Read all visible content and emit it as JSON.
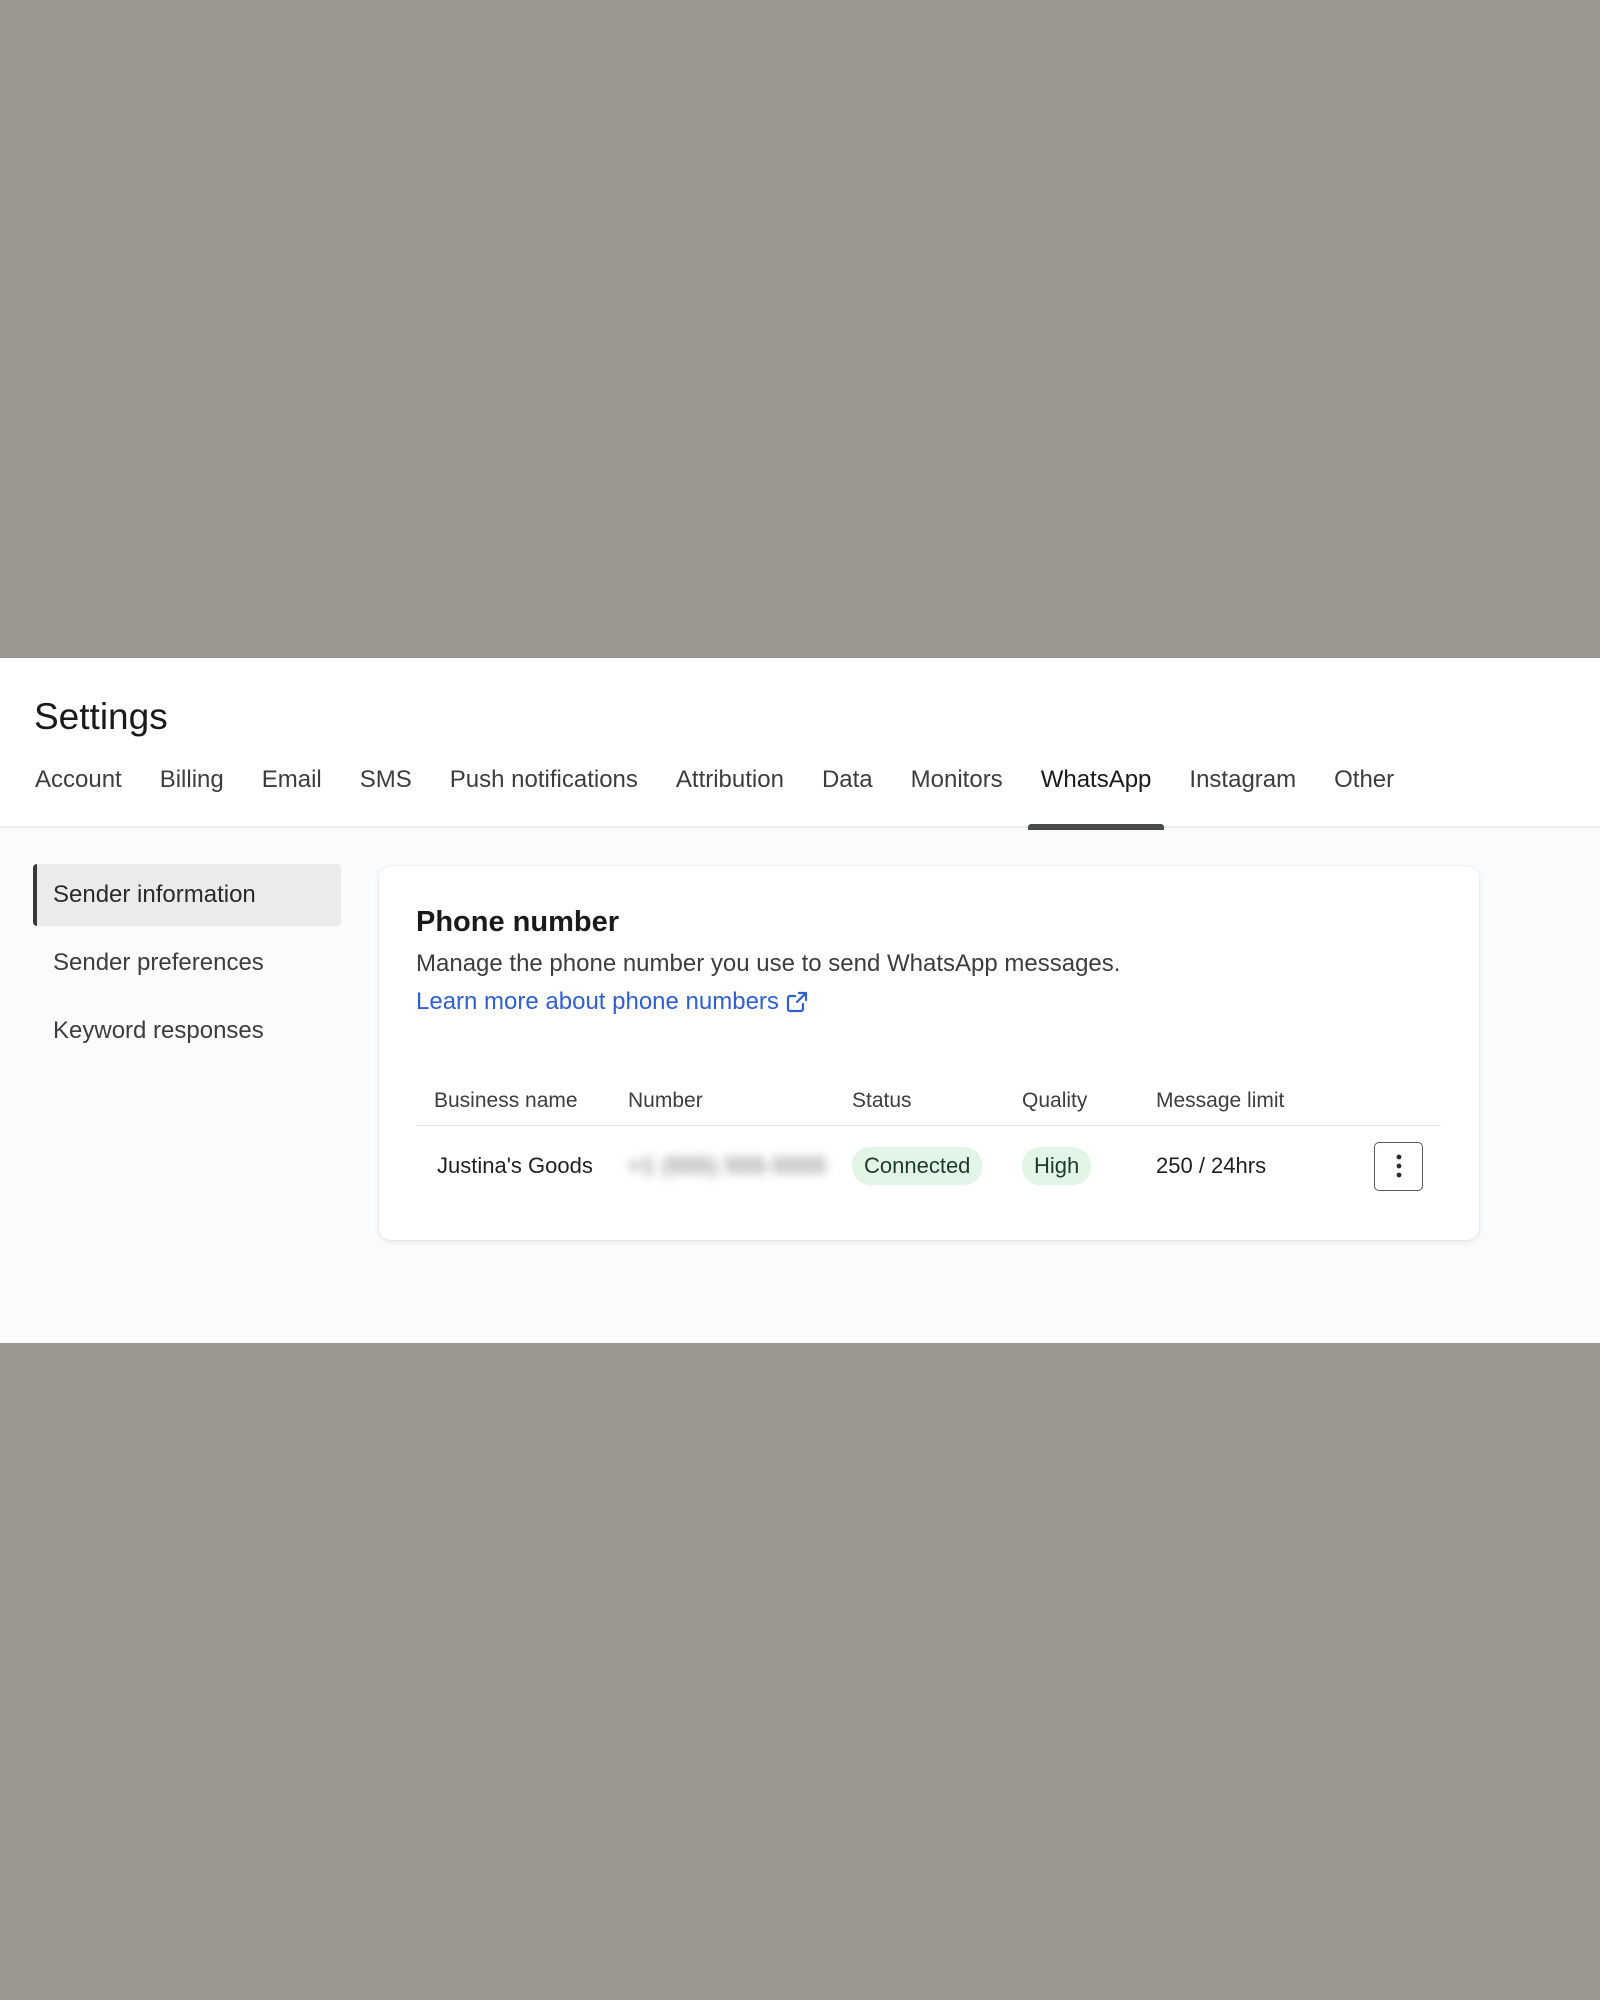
{
  "page": {
    "title": "Settings"
  },
  "tabs": [
    {
      "label": "Account"
    },
    {
      "label": "Billing"
    },
    {
      "label": "Email"
    },
    {
      "label": "SMS"
    },
    {
      "label": "Push notifications"
    },
    {
      "label": "Attribution"
    },
    {
      "label": "Data"
    },
    {
      "label": "Monitors"
    },
    {
      "label": "WhatsApp",
      "active": true
    },
    {
      "label": "Instagram"
    },
    {
      "label": "Other"
    }
  ],
  "sidenav": {
    "items": [
      {
        "label": "Sender information",
        "active": true
      },
      {
        "label": "Sender preferences"
      },
      {
        "label": "Keyword responses"
      }
    ]
  },
  "card": {
    "title": "Phone number",
    "description": "Manage the phone number you use to send WhatsApp messages.",
    "link_label": "Learn more about phone numbers",
    "link_icon": "external-link-icon"
  },
  "table": {
    "headers": [
      "Business name",
      "Number",
      "Status",
      "Quality",
      "Message limit"
    ],
    "rows": [
      {
        "business_name": "Justina's Goods",
        "number": "+1 (555) 555-5555",
        "status": "Connected",
        "quality": "High",
        "message_limit": "250 / 24hrs",
        "action_icon": "more-vertical-icon"
      }
    ]
  },
  "colors": {
    "link": "#2f5fd0",
    "badge_bg": "#e3f5e7",
    "outer_bg": "#9b9891"
  }
}
